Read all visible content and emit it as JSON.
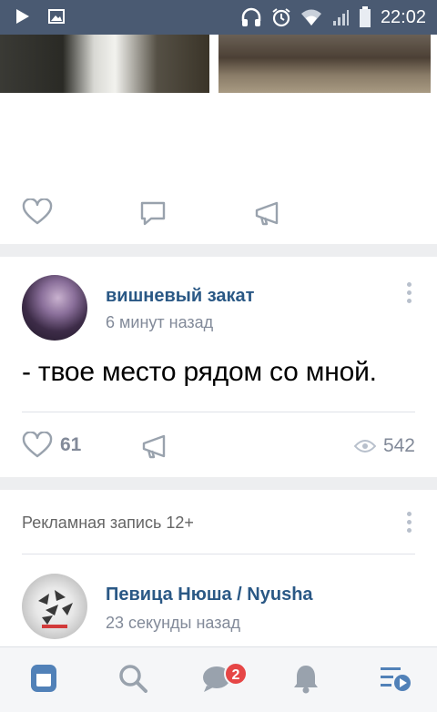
{
  "status_bar": {
    "time": "22:02",
    "icons": [
      "play-icon",
      "image-icon",
      "headphones-icon",
      "alarm-icon",
      "wifi-icon",
      "signal-icon",
      "battery-icon"
    ]
  },
  "colors": {
    "status_bar_bg": "#4a5a72",
    "link_blue": "#2a5885",
    "meta_gray": "#828a99",
    "badge_red": "#e64646",
    "nav_active": "#5181b8"
  },
  "posts": [
    {
      "actions": [
        "like-icon",
        "comment-icon",
        "share-icon"
      ]
    },
    {
      "author": "вишневый закат",
      "time": "6 минут назад",
      "text": "- твое место рядом со мной.",
      "likes": "61",
      "views": "542"
    },
    {
      "ad_label": "Рекламная запись 12+",
      "author": "Певица Нюша / Nyusha",
      "time": "23 секунды назад"
    }
  ],
  "bottom_nav": {
    "items": [
      "news-icon",
      "search-icon",
      "messages-icon",
      "notifications-icon",
      "menu-icon"
    ],
    "active": "news-icon",
    "messages_badge": "2"
  }
}
